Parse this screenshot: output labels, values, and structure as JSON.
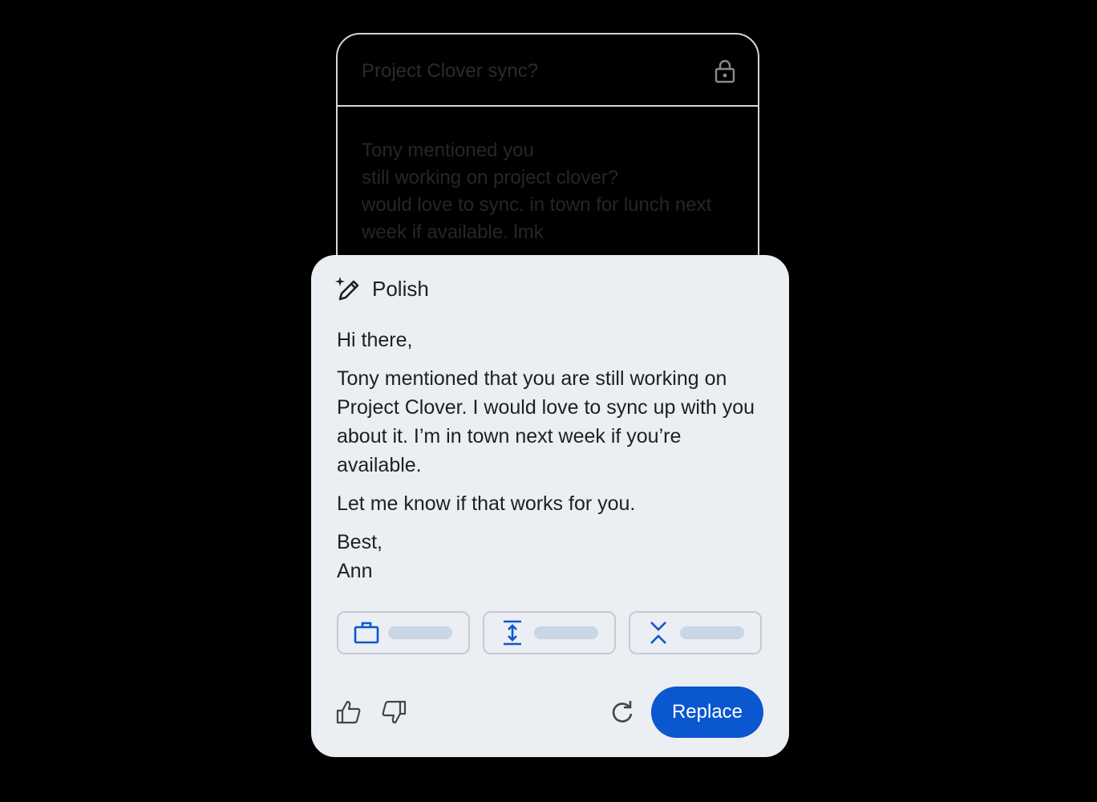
{
  "compose": {
    "subject": "Project Clover sync?",
    "lock_icon": "lock-icon",
    "body_lines": [
      "Tony mentioned you",
      "still working on project clover?",
      "would love to sync. in town for lunch next",
      "week if available. lmk"
    ]
  },
  "polish": {
    "title": "Polish",
    "title_icon": "pen-sparkle-icon",
    "greeting": "Hi there,",
    "paragraph": "Tony mentioned that you are still working on Project Clover. I would love to sync up with you about it. I’m in town next week if you’re available.",
    "closing": "Let me know if that works for you.",
    "signoff": "Best,",
    "name": "Ann",
    "chips": [
      {
        "icon": "briefcase-icon"
      },
      {
        "icon": "expand-vertical-icon"
      },
      {
        "icon": "collapse-vertical-icon"
      }
    ],
    "footer": {
      "thumbs_up_icon": "thumbs-up-icon",
      "thumbs_down_icon": "thumbs-down-icon",
      "refresh_icon": "refresh-icon",
      "replace_label": "Replace"
    }
  },
  "colors": {
    "background": "#000000",
    "card": "#ebeef3",
    "accent": "#0b57d0",
    "chip_placeholder": "#c8d6e6"
  }
}
